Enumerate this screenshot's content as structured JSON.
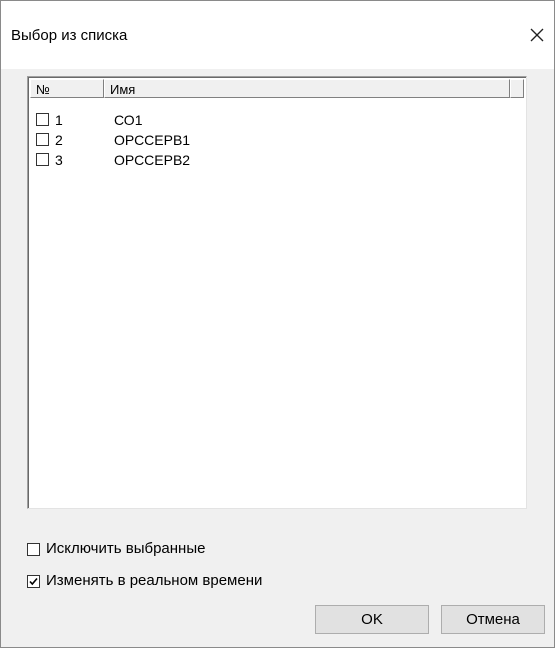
{
  "window": {
    "title": "Выбор из списка"
  },
  "list": {
    "columns": [
      "№",
      "Имя",
      ""
    ],
    "rows": [
      {
        "num": "1",
        "name": "СО1",
        "checked": false
      },
      {
        "num": "2",
        "name": "ОРССЕРВ1",
        "checked": false
      },
      {
        "num": "3",
        "name": "ОРССЕРВ2",
        "checked": false
      }
    ]
  },
  "options": {
    "exclude_selected": {
      "label": "Исключить выбранные",
      "checked": false
    },
    "realtime": {
      "label": "Изменять в реальном времени",
      "checked": true
    }
  },
  "buttons": {
    "ok": "OK",
    "cancel": "Отмена"
  },
  "icons": {
    "close": "close-icon",
    "checkbox": "checkbox-icon",
    "checkmark": "checkmark-icon"
  }
}
